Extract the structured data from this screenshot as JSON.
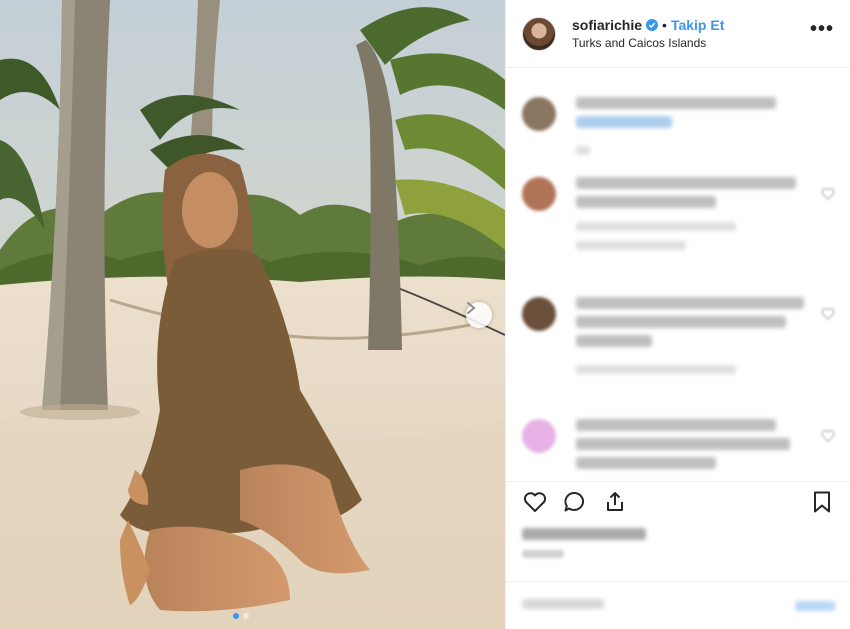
{
  "post": {
    "username": "sofiarichie",
    "separator": "•",
    "follow_label": "Takip Et",
    "location": "Turks and Caicos Islands",
    "more_label": "•••"
  },
  "carousel": {
    "slide_count": 2,
    "active_index": 0
  },
  "colors": {
    "accent": "#3897f0",
    "text": "#262626",
    "border": "#efefef"
  },
  "icons": [
    "verified-badge-icon",
    "more-options-icon",
    "chevron-right-icon",
    "heart-icon",
    "comment-icon",
    "share-icon",
    "bookmark-icon"
  ]
}
